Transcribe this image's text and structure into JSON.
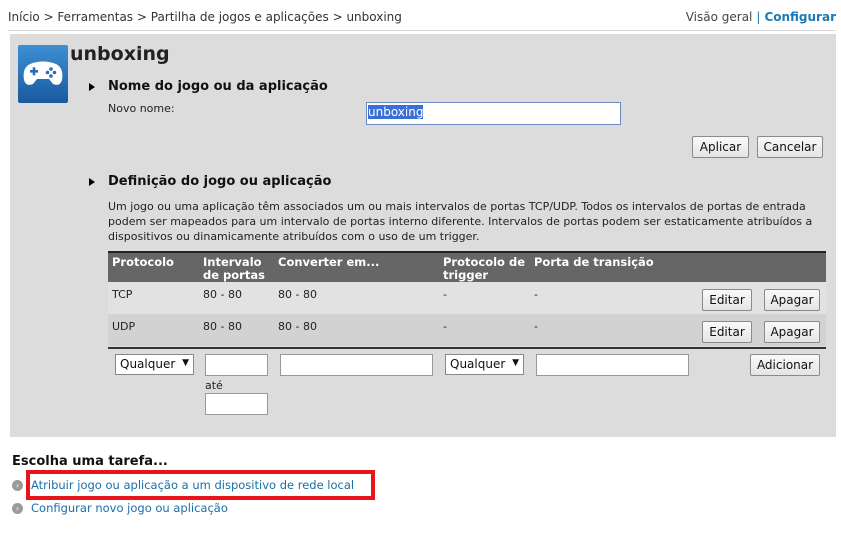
{
  "breadcrumb": "Início > Ferramentas > Partilha de jogos e aplicações > unboxing",
  "top_links": {
    "overview": "Visão geral",
    "separator": "|",
    "configure": "Configurar"
  },
  "app": {
    "title": "unboxing",
    "icon": "gamepad-icon"
  },
  "section_name": {
    "heading": "Nome do jogo ou da aplicação",
    "new_name_label": "Novo nome:",
    "new_name_value": "unboxing",
    "apply_label": "Aplicar",
    "cancel_label": "Cancelar"
  },
  "section_def": {
    "heading": "Definição do jogo ou aplicação",
    "description": "Um jogo ou uma aplicação têm associados um ou mais intervalos de portas TCP/UDP. Todos os intervalos de portas de entrada podem ser mapeados para um intervalo de portas interno diferente. Intervalos de portas podem ser estaticamente atribuídos a dispositivos ou dinamicamente atribuídos com o uso de um trigger."
  },
  "table": {
    "headers": [
      "Protocolo",
      "Intervalo de portas",
      "Converter em...",
      "Protocolo de trigger",
      "Porta de transição"
    ],
    "rows": [
      {
        "protocol": "TCP",
        "range": "80 - 80",
        "convert": "80 - 80",
        "trigger_protocol": "-",
        "trigger_port": "-",
        "edit": "Editar",
        "delete": "Apagar"
      },
      {
        "protocol": "UDP",
        "range": "80 - 80",
        "convert": "80 - 80",
        "trigger_protocol": "-",
        "trigger_port": "-",
        "edit": "Editar",
        "delete": "Apagar"
      }
    ],
    "new_row": {
      "protocol_select": "Qualquer",
      "to_label": "até",
      "trigger_select": "Qualquer",
      "add_label": "Adicionar"
    }
  },
  "tasks": {
    "title": "Escolha uma tarefa...",
    "items": [
      "Atribuir jogo ou aplicação a um dispositivo de rede local",
      "Configurar novo jogo ou aplicação"
    ]
  },
  "colors": {
    "link": "#1a7ab5",
    "panel": "#dcdcdc",
    "header": "#666666",
    "highlight": "#e8141c"
  }
}
